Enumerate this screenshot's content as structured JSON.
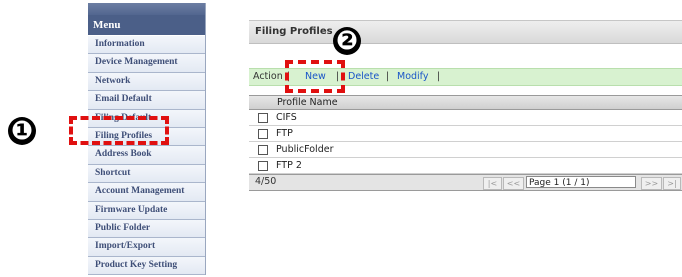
{
  "menu": {
    "header": "Menu",
    "items": [
      "Information",
      "Device Management",
      "Network",
      "Email Default",
      "Filing Default",
      "Filing Profiles",
      "Address Book",
      "Shortcut",
      "Account Management",
      "Firmware Update",
      "Public Folder",
      "Import/Export",
      "Product Key Setting"
    ]
  },
  "callouts": {
    "one": "❶",
    "two": "❷"
  },
  "panel": {
    "title": "Filing Profiles",
    "actions": {
      "label": "Action",
      "sep1": "|",
      "new": "New",
      "sep2": "|",
      "delete": "Delete",
      "sep3": "|",
      "modify": "Modify",
      "sep4": "|"
    },
    "column_header": "Profile Name",
    "rows": [
      "CIFS",
      "FTP",
      "PublicFolder",
      "FTP 2"
    ],
    "footer": {
      "count": "4/50",
      "first": "|<",
      "prev": "<<",
      "page": "Page 1 (1 / 1)",
      "next": ">>",
      "last": ">|"
    }
  },
  "colors": {
    "menu_header": "#4b5f88",
    "action_bar": "#d8f2d0",
    "callout_box": "#e01010",
    "link": "#1a56c8"
  }
}
